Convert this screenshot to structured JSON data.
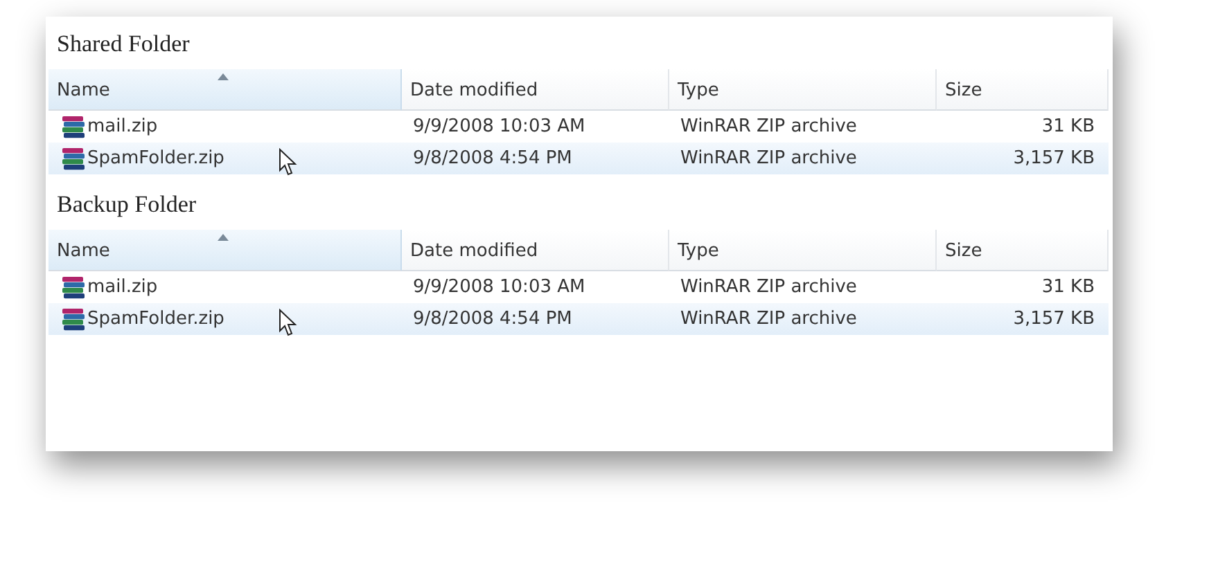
{
  "sections": [
    {
      "title": "Shared Folder",
      "columns": [
        {
          "label": "Name",
          "sorted": true
        },
        {
          "label": "Date modified",
          "sorted": false
        },
        {
          "label": "Type",
          "sorted": false
        },
        {
          "label": "Size",
          "sorted": false
        }
      ],
      "rows": [
        {
          "name": "mail.zip",
          "date": "9/9/2008 10:03 AM",
          "type": "WinRAR ZIP archive",
          "size": "31 KB",
          "hovered": false
        },
        {
          "name": "SpamFolder.zip",
          "date": "9/8/2008 4:54 PM",
          "type": "WinRAR ZIP archive",
          "size": "3,157 KB",
          "hovered": true
        }
      ]
    },
    {
      "title": "Backup Folder",
      "columns": [
        {
          "label": "Name",
          "sorted": true
        },
        {
          "label": "Date modified",
          "sorted": false
        },
        {
          "label": "Type",
          "sorted": false
        },
        {
          "label": "Size",
          "sorted": false
        }
      ],
      "rows": [
        {
          "name": "mail.zip",
          "date": "9/9/2008 10:03 AM",
          "type": "WinRAR ZIP archive",
          "size": "31 KB",
          "hovered": false
        },
        {
          "name": "SpamFolder.zip",
          "date": "9/8/2008 4:54 PM",
          "type": "WinRAR ZIP archive",
          "size": "3,157 KB",
          "hovered": true
        }
      ]
    }
  ]
}
